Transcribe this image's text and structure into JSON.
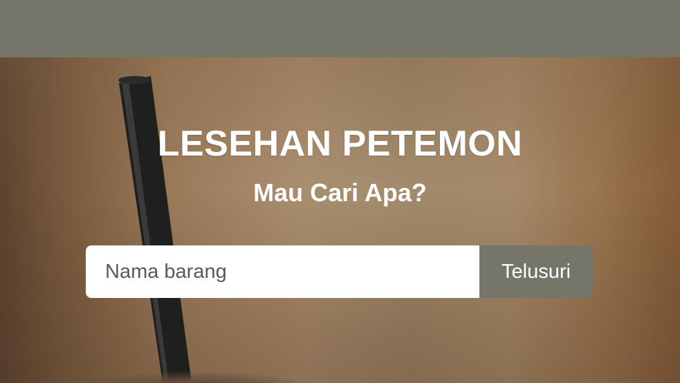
{
  "header": {
    "background_color": "#76756a"
  },
  "hero": {
    "title": "LESEHAN PETEMON",
    "subtitle": "Mau Cari Apa?",
    "background_image": "iced-coffee-with-straw-photo"
  },
  "search": {
    "placeholder": "Nama barang",
    "value": "",
    "button_label": "Telusuri",
    "button_color": "#76756a"
  }
}
